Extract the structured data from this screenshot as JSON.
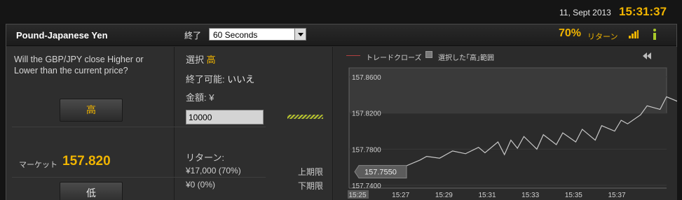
{
  "topbar": {
    "date": "11, Sept 2013",
    "time": "15:31:37"
  },
  "header": {
    "pair": "Pound-Japanese Yen",
    "expiry_label": "終了",
    "expiry_value": "60 Seconds",
    "return_pct": "70%",
    "return_label": "リターン",
    "signal_icon": "signal-bars-icon",
    "info_icon": "info-icon"
  },
  "trade": {
    "question": "Will the GBP/JPY close Higher or Lower than the current price?",
    "high_button": "高",
    "low_button": "低",
    "market_label": "マーケット",
    "market_value": "157.820"
  },
  "order": {
    "selection_label": "選択",
    "selection_value": "高",
    "close_label": "終了可能:",
    "close_value": "いいえ",
    "amount_label": "金額: ¥",
    "amount_value": "10000",
    "return_label": "リターン:",
    "upper_value": "¥17,000 (70%)",
    "upper_label": "上期限",
    "lower_value": "¥0 (0%)",
    "lower_label": "下期限"
  },
  "chart_legend": {
    "trade_close": "トレードクローズ",
    "selected_range": "選択した｢高｣範囲"
  },
  "colors": {
    "accent": "#f0b400",
    "info": "#a8c92a",
    "line": "#c8c8c8"
  },
  "chart_data": {
    "type": "line",
    "x_ticks": [
      "15:25",
      "15:27",
      "15:29",
      "15:31",
      "15:33",
      "15:35",
      "15:37"
    ],
    "y_ticks": [
      "157.8600",
      "157.8200",
      "157.7800",
      "157.7400"
    ],
    "ylim": [
      157.74,
      157.87
    ],
    "highlight_range": [
      157.82,
      157.87
    ],
    "current_label": "157.7550",
    "series": [
      {
        "x": [
          15.4167,
          15.43,
          15.44,
          15.45,
          15.455,
          15.465,
          15.47,
          15.48,
          15.49,
          15.5,
          15.51,
          15.515,
          15.525,
          15.53,
          15.535,
          15.54,
          15.545,
          15.555,
          15.56,
          15.57,
          15.575,
          15.585,
          15.59,
          15.6,
          15.605,
          15.615,
          15.62,
          15.625,
          15.635,
          15.64,
          15.65,
          15.655,
          15.665,
          15.67,
          15.68,
          15.685,
          15.69,
          15.7,
          15.705,
          15.715,
          15.72,
          15.725,
          15.735,
          15.74,
          15.75,
          15.755,
          15.76,
          15.77,
          15.775,
          15.78,
          15.79,
          15.795,
          15.8,
          15.81,
          15.815,
          15.823,
          15.83,
          15.84,
          15.845,
          15.85,
          15.86,
          15.865,
          15.87,
          15.88,
          15.885,
          15.893,
          15.9,
          15.91,
          15.918
        ],
        "y": [
          157.755,
          157.752,
          157.758,
          157.756,
          157.762,
          157.768,
          157.772,
          157.77,
          157.778,
          157.775,
          157.782,
          157.776,
          157.788,
          157.774,
          157.79,
          157.781,
          157.794,
          157.78,
          157.796,
          157.785,
          157.798,
          157.788,
          157.802,
          157.79,
          157.806,
          157.8,
          157.812,
          157.808,
          157.818,
          157.828,
          157.824,
          157.838,
          157.832,
          157.846,
          157.848,
          157.852,
          157.842,
          157.84,
          157.846,
          157.836,
          157.844,
          157.834,
          157.844,
          157.838,
          157.84,
          157.832,
          157.838,
          157.83,
          157.822,
          157.826,
          157.818,
          157.822,
          157.814,
          157.82,
          157.812,
          157.818,
          157.816,
          157.82,
          157.812,
          157.818,
          157.81,
          157.816,
          157.812,
          157.818,
          157.816,
          157.82,
          157.818,
          157.821,
          157.82
        ]
      }
    ]
  }
}
